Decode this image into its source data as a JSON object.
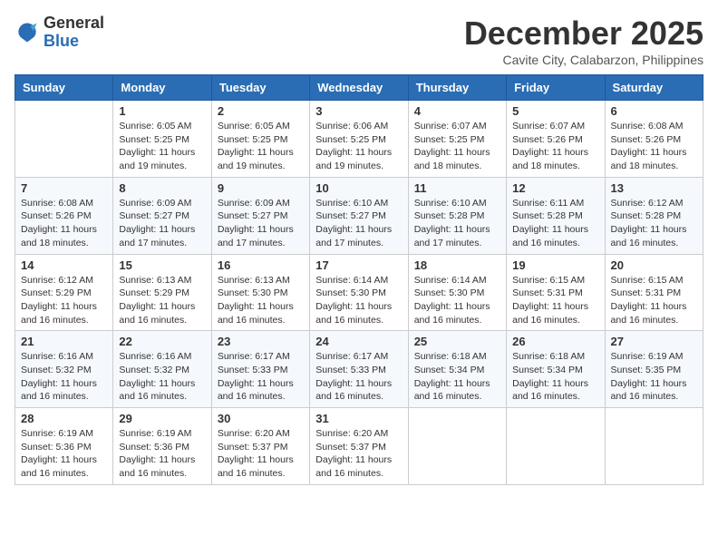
{
  "logo": {
    "general": "General",
    "blue": "Blue"
  },
  "title": "December 2025",
  "location": "Cavite City, Calabarzon, Philippines",
  "days_of_week": [
    "Sunday",
    "Monday",
    "Tuesday",
    "Wednesday",
    "Thursday",
    "Friday",
    "Saturday"
  ],
  "weeks": [
    [
      {
        "day": "",
        "info": ""
      },
      {
        "day": "1",
        "info": "Sunrise: 6:05 AM\nSunset: 5:25 PM\nDaylight: 11 hours and 19 minutes."
      },
      {
        "day": "2",
        "info": "Sunrise: 6:05 AM\nSunset: 5:25 PM\nDaylight: 11 hours and 19 minutes."
      },
      {
        "day": "3",
        "info": "Sunrise: 6:06 AM\nSunset: 5:25 PM\nDaylight: 11 hours and 19 minutes."
      },
      {
        "day": "4",
        "info": "Sunrise: 6:07 AM\nSunset: 5:25 PM\nDaylight: 11 hours and 18 minutes."
      },
      {
        "day": "5",
        "info": "Sunrise: 6:07 AM\nSunset: 5:26 PM\nDaylight: 11 hours and 18 minutes."
      },
      {
        "day": "6",
        "info": "Sunrise: 6:08 AM\nSunset: 5:26 PM\nDaylight: 11 hours and 18 minutes."
      }
    ],
    [
      {
        "day": "7",
        "info": "Sunrise: 6:08 AM\nSunset: 5:26 PM\nDaylight: 11 hours and 18 minutes."
      },
      {
        "day": "8",
        "info": "Sunrise: 6:09 AM\nSunset: 5:27 PM\nDaylight: 11 hours and 17 minutes."
      },
      {
        "day": "9",
        "info": "Sunrise: 6:09 AM\nSunset: 5:27 PM\nDaylight: 11 hours and 17 minutes."
      },
      {
        "day": "10",
        "info": "Sunrise: 6:10 AM\nSunset: 5:27 PM\nDaylight: 11 hours and 17 minutes."
      },
      {
        "day": "11",
        "info": "Sunrise: 6:10 AM\nSunset: 5:28 PM\nDaylight: 11 hours and 17 minutes."
      },
      {
        "day": "12",
        "info": "Sunrise: 6:11 AM\nSunset: 5:28 PM\nDaylight: 11 hours and 16 minutes."
      },
      {
        "day": "13",
        "info": "Sunrise: 6:12 AM\nSunset: 5:28 PM\nDaylight: 11 hours and 16 minutes."
      }
    ],
    [
      {
        "day": "14",
        "info": "Sunrise: 6:12 AM\nSunset: 5:29 PM\nDaylight: 11 hours and 16 minutes."
      },
      {
        "day": "15",
        "info": "Sunrise: 6:13 AM\nSunset: 5:29 PM\nDaylight: 11 hours and 16 minutes."
      },
      {
        "day": "16",
        "info": "Sunrise: 6:13 AM\nSunset: 5:30 PM\nDaylight: 11 hours and 16 minutes."
      },
      {
        "day": "17",
        "info": "Sunrise: 6:14 AM\nSunset: 5:30 PM\nDaylight: 11 hours and 16 minutes."
      },
      {
        "day": "18",
        "info": "Sunrise: 6:14 AM\nSunset: 5:30 PM\nDaylight: 11 hours and 16 minutes."
      },
      {
        "day": "19",
        "info": "Sunrise: 6:15 AM\nSunset: 5:31 PM\nDaylight: 11 hours and 16 minutes."
      },
      {
        "day": "20",
        "info": "Sunrise: 6:15 AM\nSunset: 5:31 PM\nDaylight: 11 hours and 16 minutes."
      }
    ],
    [
      {
        "day": "21",
        "info": "Sunrise: 6:16 AM\nSunset: 5:32 PM\nDaylight: 11 hours and 16 minutes."
      },
      {
        "day": "22",
        "info": "Sunrise: 6:16 AM\nSunset: 5:32 PM\nDaylight: 11 hours and 16 minutes."
      },
      {
        "day": "23",
        "info": "Sunrise: 6:17 AM\nSunset: 5:33 PM\nDaylight: 11 hours and 16 minutes."
      },
      {
        "day": "24",
        "info": "Sunrise: 6:17 AM\nSunset: 5:33 PM\nDaylight: 11 hours and 16 minutes."
      },
      {
        "day": "25",
        "info": "Sunrise: 6:18 AM\nSunset: 5:34 PM\nDaylight: 11 hours and 16 minutes."
      },
      {
        "day": "26",
        "info": "Sunrise: 6:18 AM\nSunset: 5:34 PM\nDaylight: 11 hours and 16 minutes."
      },
      {
        "day": "27",
        "info": "Sunrise: 6:19 AM\nSunset: 5:35 PM\nDaylight: 11 hours and 16 minutes."
      }
    ],
    [
      {
        "day": "28",
        "info": "Sunrise: 6:19 AM\nSunset: 5:36 PM\nDaylight: 11 hours and 16 minutes."
      },
      {
        "day": "29",
        "info": "Sunrise: 6:19 AM\nSunset: 5:36 PM\nDaylight: 11 hours and 16 minutes."
      },
      {
        "day": "30",
        "info": "Sunrise: 6:20 AM\nSunset: 5:37 PM\nDaylight: 11 hours and 16 minutes."
      },
      {
        "day": "31",
        "info": "Sunrise: 6:20 AM\nSunset: 5:37 PM\nDaylight: 11 hours and 16 minutes."
      },
      {
        "day": "",
        "info": ""
      },
      {
        "day": "",
        "info": ""
      },
      {
        "day": "",
        "info": ""
      }
    ]
  ]
}
